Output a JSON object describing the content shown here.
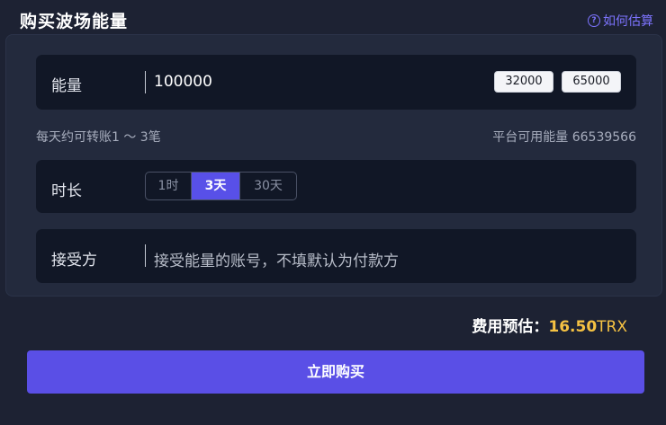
{
  "header": {
    "title": "购买波场能量",
    "help_label": "如何估算",
    "help_icon": "question-circle-icon"
  },
  "energy": {
    "label": "能量",
    "value": "100000",
    "presets": [
      "32000",
      "65000"
    ]
  },
  "hints": {
    "transfers": "每天约可转账1 ～ 3笔",
    "available": "平台可用能量 66539566"
  },
  "duration": {
    "label": "时长",
    "options": [
      "1时",
      "3天",
      "30天"
    ],
    "selected": "3天"
  },
  "receiver": {
    "label": "接受方",
    "placeholder": "接受能量的账号，不填默认为付款方"
  },
  "fee": {
    "label": "费用预估：",
    "amount": "16.50",
    "unit": "TRX"
  },
  "submit_label": "立即购买",
  "colors": {
    "accent": "#5a4fe6",
    "fee_highlight": "#f5c243",
    "help_link": "#7d74ff"
  }
}
